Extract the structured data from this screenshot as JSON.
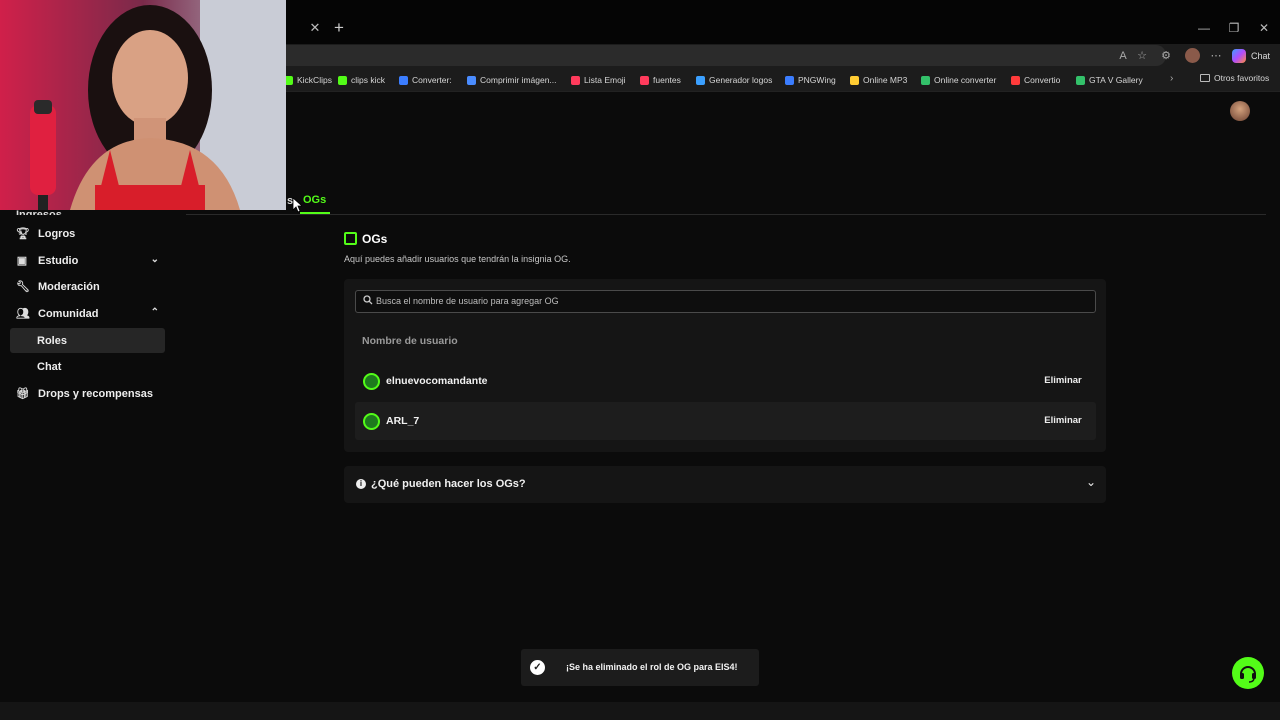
{
  "browser": {
    "bookmarks": [
      {
        "label": "KickClips",
        "color": "#53fc18"
      },
      {
        "label": "clips kick",
        "color": "#53fc18"
      },
      {
        "label": "Converter:",
        "color": "#3b7dff"
      },
      {
        "label": "Comprimir imágen...",
        "color": "#4a8cff"
      },
      {
        "label": "Lista Emoji",
        "color": "#ff3b5c"
      },
      {
        "label": "fuentes",
        "color": "#ff3b5c"
      },
      {
        "label": "Generador logos",
        "color": "#3ba0ff"
      },
      {
        "label": "PNGWing",
        "color": "#3b7dff"
      },
      {
        "label": "Online MP3",
        "color": "#ffcc33"
      },
      {
        "label": "Online converter",
        "color": "#33c16a"
      },
      {
        "label": "Convertio",
        "color": "#ff3b3b"
      },
      {
        "label": "GTA V Gallery",
        "color": "#33c16a"
      }
    ],
    "other_favorites": "Otros favoritos",
    "chat_label": "Chat"
  },
  "tabs": {
    "prev_partial": "s",
    "active": "OGs"
  },
  "sidebar": {
    "partial_top": "Ingresos",
    "items": [
      {
        "label": "Logros",
        "icon": "trophy-icon"
      },
      {
        "label": "Estudio",
        "icon": "studio-icon",
        "chevron": "down"
      },
      {
        "label": "Moderación",
        "icon": "wrench-icon"
      },
      {
        "label": "Comunidad",
        "icon": "community-icon",
        "chevron": "up"
      },
      {
        "label": "Roles",
        "active": true
      },
      {
        "label": "Chat"
      },
      {
        "label": "Drops y recompensas",
        "icon": "drops-icon"
      }
    ]
  },
  "section": {
    "title": "OGs",
    "description": "Aquí puedes añadir usuarios que tendrán la insignia OG."
  },
  "search": {
    "placeholder": "Busca el nombre de usuario para agregar OG"
  },
  "table": {
    "column_header": "Nombre de usuario",
    "rows": [
      {
        "username": "elnuevocomandante",
        "action": "Eliminar"
      },
      {
        "username": "ARL_7",
        "action": "Eliminar"
      }
    ]
  },
  "faq": {
    "question": "¿Qué pueden hacer los OGs?"
  },
  "toast": {
    "message": "¡Se ha eliminado el rol de OG para EIS4!"
  },
  "colors": {
    "accent": "#53fc18",
    "background": "#0b0b0b",
    "card": "#151515"
  }
}
